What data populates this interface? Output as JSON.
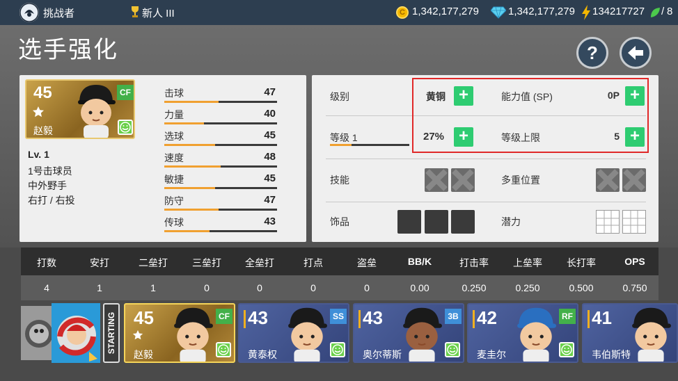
{
  "topbar": {
    "mode_label": "挑战者",
    "rank_label": "新人 III",
    "gold": "1,342,177,279",
    "gems": "1,342,177,279",
    "energy": "134217727",
    "energy_max": "8",
    "energy_separator": "/"
  },
  "page": {
    "title": "选手强化",
    "help_label": "?",
    "back_label": "back"
  },
  "player_card": {
    "overall": "45",
    "position": "CF",
    "name": "赵毅",
    "level": "Lv. 1",
    "order": "1号击球员",
    "role": "中外野手",
    "hand": "右打 / 右投"
  },
  "stats": [
    {
      "label": "击球",
      "value": "47",
      "fill": 0.48
    },
    {
      "label": "力量",
      "value": "40",
      "fill": 0.35
    },
    {
      "label": "选球",
      "value": "45",
      "fill": 0.45
    },
    {
      "label": "速度",
      "value": "48",
      "fill": 0.5
    },
    {
      "label": "敏捷",
      "value": "45",
      "fill": 0.45
    },
    {
      "label": "防守",
      "value": "47",
      "fill": 0.48
    },
    {
      "label": "传球",
      "value": "43",
      "fill": 0.4
    }
  ],
  "upgrade": {
    "grade_label": "级别",
    "grade_value": "黄铜",
    "ability_label": "能力值 (SP)",
    "ability_value": "0P",
    "level_label": "等级 1",
    "level_percent": "27%",
    "level_progress": 0.27,
    "level_cap_label": "等级上限",
    "level_cap_value": "5",
    "plus": "+",
    "skill_label": "技能",
    "multi_pos_label": "多重位置",
    "accessory_label": "饰品",
    "potential_label": "潜力"
  },
  "batting": {
    "headers": [
      "打数",
      "安打",
      "二垒打",
      "三垒打",
      "全垒打",
      "打点",
      "盗垒",
      "BB/K",
      "打击率",
      "上垒率",
      "长打率",
      "OPS"
    ],
    "values": [
      "4",
      "1",
      "1",
      "0",
      "0",
      "0",
      "0",
      "0.00",
      "0.250",
      "0.250",
      "0.500",
      "0.750"
    ]
  },
  "lineup": {
    "starting_label": "STARTING",
    "players": [
      {
        "overall": "45",
        "position": "CF",
        "name": "赵毅",
        "selected": true,
        "pos_color": "#43b04a"
      },
      {
        "overall": "43",
        "position": "SS",
        "name": "黄泰权",
        "selected": false,
        "pos_color": "#3f8fd8"
      },
      {
        "overall": "43",
        "position": "3B",
        "name": "奥尔蒂斯",
        "selected": false,
        "pos_color": "#3f8fd8"
      },
      {
        "overall": "42",
        "position": "RF",
        "name": "麦圭尔",
        "selected": false,
        "pos_color": "#43b04a"
      },
      {
        "overall": "41",
        "position": "",
        "name": "韦伯斯特",
        "selected": false,
        "pos_color": "#43b04a"
      }
    ]
  },
  "colors": {
    "accent_green": "#2ecc71",
    "highlight_red": "#e02828",
    "bar_orange": "#f0a030",
    "topbar": "#2d3e50",
    "team_blue": "#3d4f86"
  }
}
